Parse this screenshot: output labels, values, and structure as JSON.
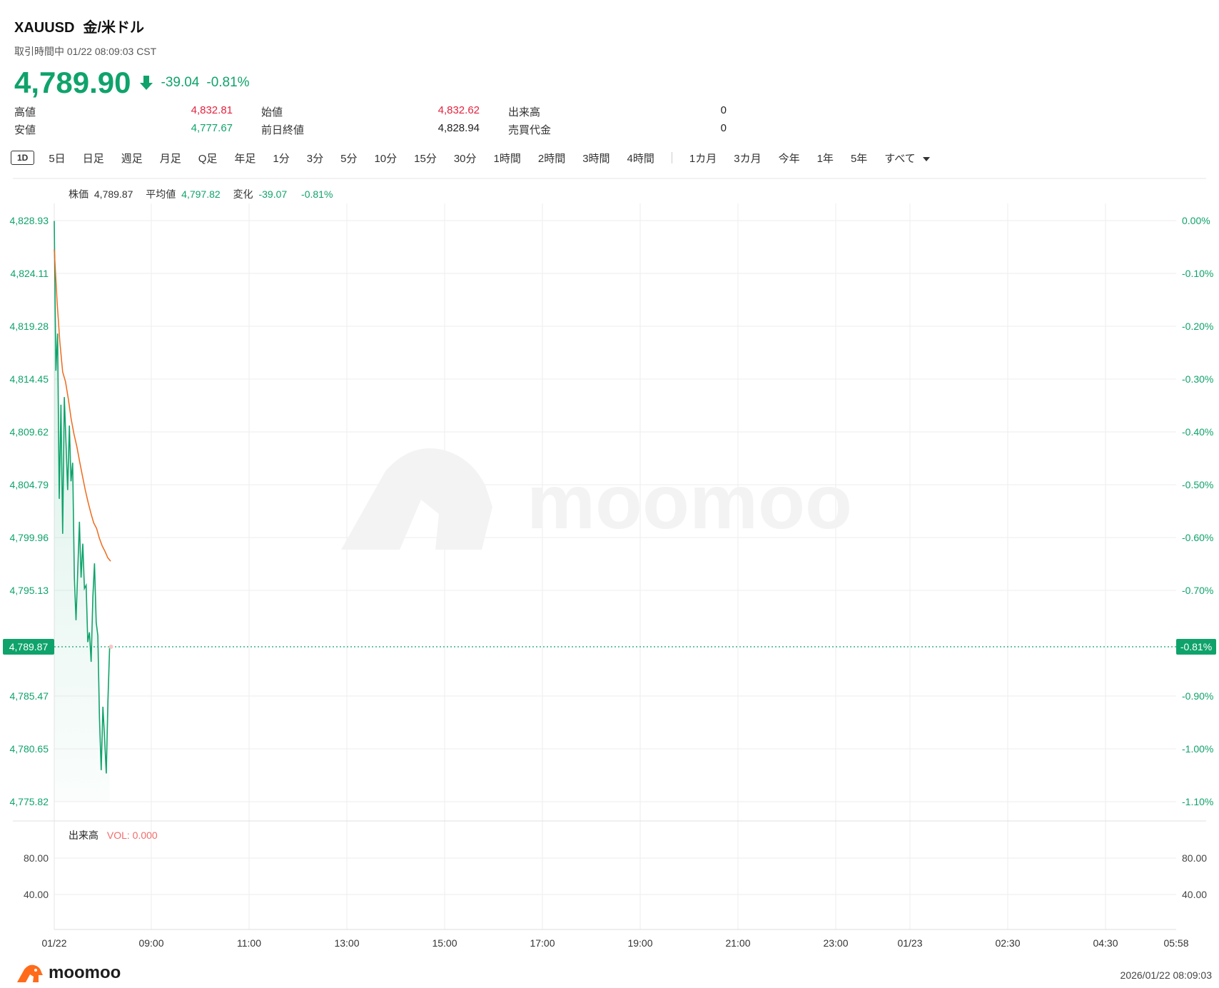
{
  "header": {
    "symbol": "XAUUSD",
    "name": "金/米ドル",
    "status": "取引時間中 01/22 08:09:03 CST",
    "last_price": "4,789.90",
    "change": "-39.04",
    "change_pct": "-0.81%",
    "direction_icon": "arrow-down-icon"
  },
  "stats": {
    "high_label": "高値",
    "high_value": "4,832.81",
    "low_label": "安値",
    "low_value": "4,777.67",
    "open_label": "始値",
    "open_value": "4,832.62",
    "prev_close_label": "前日終値",
    "prev_close_value": "4,828.94",
    "volume_label": "出来高",
    "volume_value": "0",
    "turnover_label": "売買代金",
    "turnover_value": "0"
  },
  "toolbar": {
    "active": "1D",
    "items": [
      "5日",
      "日足",
      "週足",
      "月足",
      "Q足",
      "年足",
      "1分",
      "3分",
      "5分",
      "10分",
      "15分",
      "30分",
      "1時間",
      "2時間",
      "3時間",
      "4時間"
    ],
    "range_items": [
      "1カ月",
      "3カ月",
      "今年",
      "1年",
      "5年"
    ],
    "more_label": "すべて"
  },
  "legend": {
    "price_label": "株価",
    "price_value": "4,789.87",
    "avg_label": "平均値",
    "avg_value": "4,797.82",
    "change_label": "変化",
    "change_value": "-39.07",
    "change_pct": "-0.81%"
  },
  "volume_legend": {
    "label": "出来高",
    "vol_text": "VOL: 0.000"
  },
  "watermark": "moomoo",
  "footer": {
    "brand": "moomoo",
    "timestamp": "2026/01/22 08:09:03"
  },
  "colors": {
    "up_green": "#0fa36b",
    "down_red": "#e2233f",
    "avg_line": "#ee6a1c",
    "grid": "#eeeeee"
  },
  "chart_data": {
    "type": "line",
    "y_ticks_left": [
      "4,828.93",
      "4,824.11",
      "4,819.28",
      "4,814.45",
      "4,809.62",
      "4,804.79",
      "4,799.96",
      "4,795.13",
      "4,789.87",
      "4,785.47",
      "4,780.65",
      "4,775.82"
    ],
    "y_ticks_right": [
      "0.00%",
      "-0.10%",
      "-0.20%",
      "-0.30%",
      "-0.40%",
      "-0.50%",
      "-0.60%",
      "-0.70%",
      "-0.81%",
      "-0.90%",
      "-1.00%",
      "-1.10%"
    ],
    "highlight_left": "4,789.87",
    "highlight_right": "-0.81%",
    "ylim": [
      4775.82,
      4828.93
    ],
    "x_ticks": [
      "01/22",
      "09:00",
      "11:00",
      "13:00",
      "15:00",
      "17:00",
      "19:00",
      "21:00",
      "23:00",
      "01/23",
      "02:30",
      "04:30",
      "05:58"
    ],
    "vol_y_ticks": [
      "80.00",
      "40.00"
    ],
    "series": [
      {
        "name": "株価",
        "y": [
          4828.9,
          4815.2,
          4818.6,
          4803.5,
          4812.1,
          4800.3,
          4812.8,
          4808.6,
          4804.3,
          4810.2,
          4805.1,
          4806.8,
          4796.3,
          4792.4,
          4796.9,
          4801.4,
          4796.3,
          4799.4,
          4795.3,
          4795.6,
          4790.4,
          4791.3,
          4788.6,
          4794.5,
          4797.6,
          4792.2,
          4791.0,
          4783.4,
          4778.7,
          4784.5,
          4781.7,
          4778.4,
          4785.0,
          4789.9
        ]
      },
      {
        "name": "平均値",
        "y": [
          4826.3,
          4821.5,
          4817.8,
          4815.1,
          4814.2,
          4812.6,
          4810.8,
          4809.4,
          4808.3,
          4806.9,
          4805.6,
          4804.3,
          4803.2,
          4802.2,
          4801.3,
          4800.8,
          4799.9,
          4799.2,
          4798.7,
          4798.1,
          4797.8
        ]
      }
    ]
  }
}
